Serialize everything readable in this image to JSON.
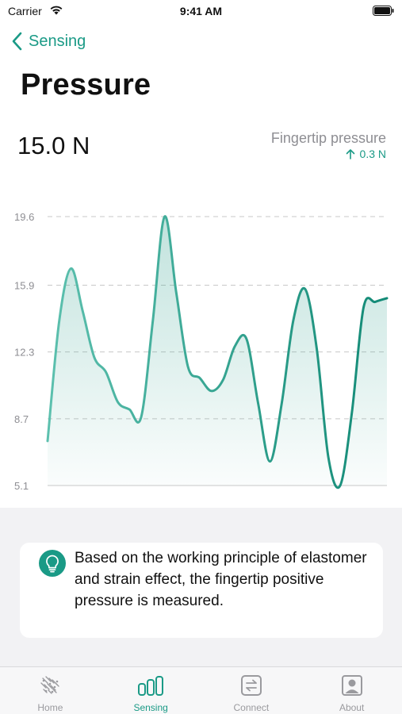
{
  "status_bar": {
    "carrier": "Carrier",
    "time": "9:41 AM"
  },
  "nav": {
    "back_label": "Sensing"
  },
  "page": {
    "title": "Pressure",
    "current_value": "15.0 N"
  },
  "metric": {
    "name": "Fingertip pressure",
    "change": "0.3 N"
  },
  "colors": {
    "accent": "#1a9a86",
    "chart_line": "#239a86",
    "grid": "#c8c8c8",
    "background_gray": "#f2f2f4"
  },
  "chart_data": {
    "type": "area",
    "title": "",
    "xlabel": "",
    "ylabel": "",
    "ylim": [
      5.1,
      19.6
    ],
    "y_ticks": [
      "19.6",
      "15.9",
      "12.3",
      "8.7",
      "5.1"
    ],
    "y_tick_values": [
      19.6,
      15.9,
      12.3,
      8.7,
      5.1
    ],
    "grid": true,
    "x": [
      0,
      1,
      2,
      3,
      4,
      5,
      6,
      7,
      8,
      9,
      10,
      11,
      12,
      13,
      14,
      15,
      16,
      17,
      18,
      19,
      20,
      21,
      22,
      23,
      24,
      25,
      26,
      27,
      28,
      29,
      30,
      31,
      32,
      33,
      34,
      35
    ],
    "values": [
      7.5,
      14.0,
      16.8,
      14.5,
      12.0,
      11.2,
      9.6,
      9.2,
      8.8,
      14.0,
      19.6,
      15.5,
      11.5,
      10.9,
      10.2,
      10.8,
      12.6,
      13.0,
      9.5,
      6.4,
      9.5,
      14.0,
      15.7,
      12.5,
      6.6,
      5.1,
      9.0,
      14.7,
      15.0,
      15.2
    ],
    "series": [
      {
        "color": "#239a86"
      }
    ]
  },
  "info": {
    "icon": "bulb-icon",
    "text": "Based on the working principle of elastomer and strain effect, the fingertip positive pressure is measured."
  },
  "tabbar": {
    "items": [
      {
        "label": "Home",
        "icon": "home-pattern-icon",
        "active": false
      },
      {
        "label": "Sensing",
        "icon": "bar-chart-icon",
        "active": true
      },
      {
        "label": "Connect",
        "icon": "connect-icon",
        "active": false
      },
      {
        "label": "About",
        "icon": "person-icon",
        "active": false
      }
    ]
  }
}
